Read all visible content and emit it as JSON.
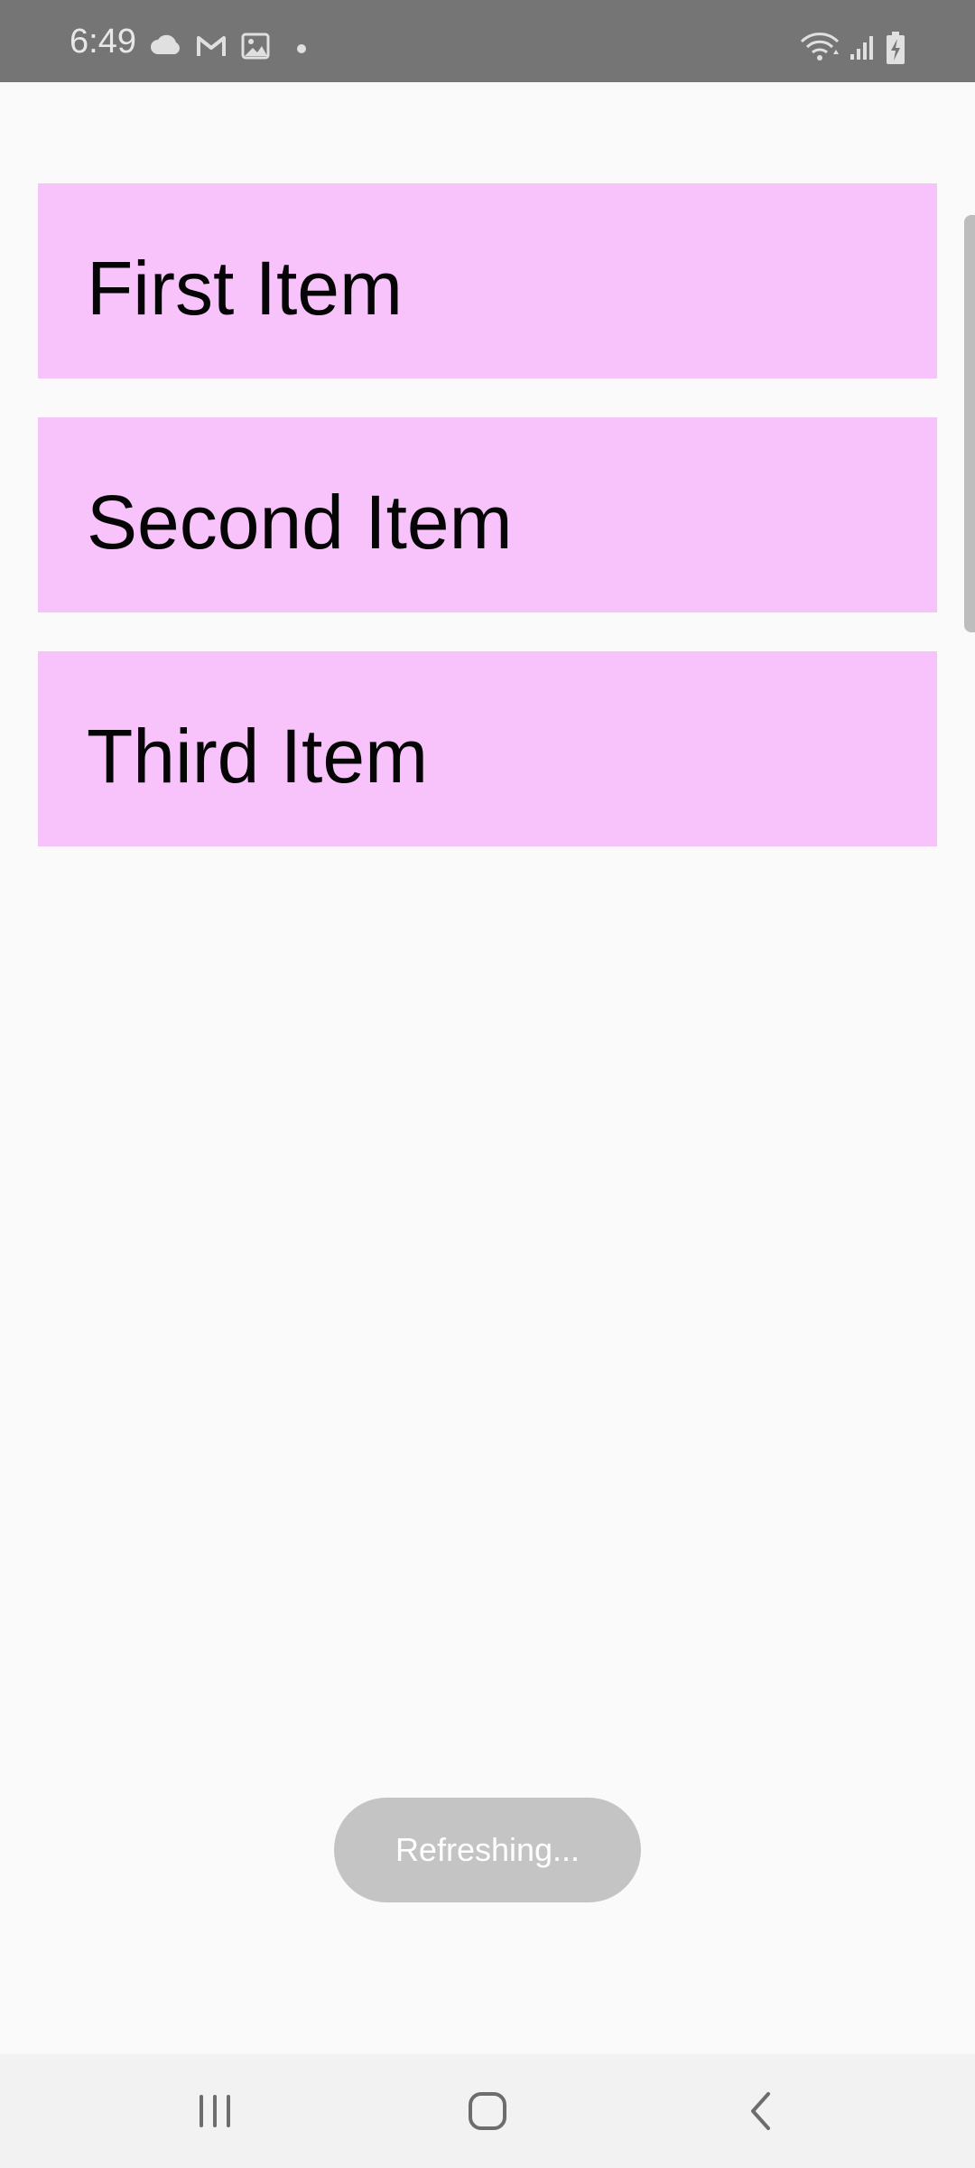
{
  "status_bar": {
    "time": "6:49",
    "left_icons": [
      "cloud-icon",
      "gmail-icon",
      "gallery-icon",
      "dot-icon"
    ],
    "right_icons": [
      "wifi-icon",
      "signal-icon",
      "battery-charging-icon"
    ]
  },
  "list": {
    "items": [
      {
        "label": "First Item"
      },
      {
        "label": "Second Item"
      },
      {
        "label": "Third Item"
      }
    ],
    "item_color": "#f8c3fb"
  },
  "toast": {
    "text": "Refreshing..."
  },
  "nav_bar": {
    "buttons": [
      "recent-apps-icon",
      "home-icon",
      "back-icon"
    ]
  }
}
